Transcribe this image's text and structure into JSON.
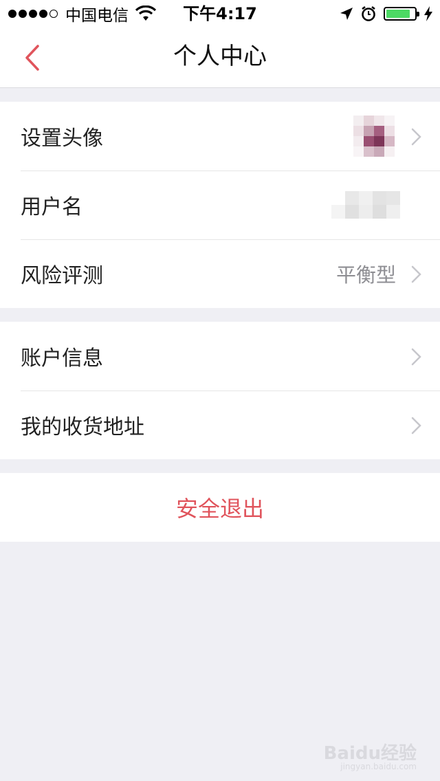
{
  "status_bar": {
    "carrier": "中国电信",
    "time": "下午4:17",
    "battery_level": 0.85
  },
  "nav": {
    "title": "个人中心",
    "back_icon": "chevron-left-icon"
  },
  "profile_group": [
    {
      "label": "设置头像",
      "value": ""
    },
    {
      "label": "用户名",
      "value": ""
    },
    {
      "label": "风险评测",
      "value": "平衡型"
    }
  ],
  "account_group": [
    {
      "label": "账户信息"
    },
    {
      "label": "我的收货地址"
    }
  ],
  "logout": {
    "label": "安全退出"
  },
  "watermark": {
    "brand": "Baidu经验",
    "url": "jingyan.baidu.com"
  },
  "colors": {
    "accent": "#e0545c",
    "background": "#efeff4",
    "secondary_text": "#8e8e93",
    "battery": "#4cd964"
  }
}
